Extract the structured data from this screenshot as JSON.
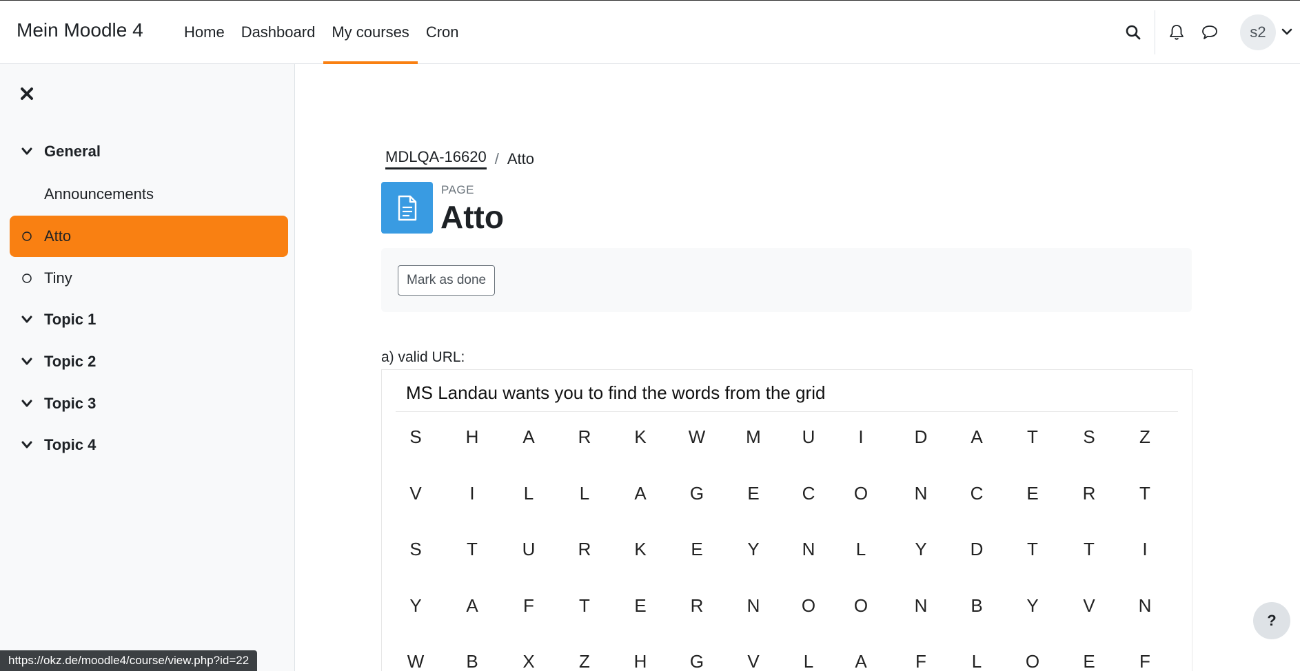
{
  "navbar": {
    "brand": "Mein Moodle 4",
    "links": [
      {
        "label": "Home"
      },
      {
        "label": "Dashboard"
      },
      {
        "label": "My courses",
        "active": true
      },
      {
        "label": "Cron"
      }
    ],
    "user_initials": "s2",
    "icons": [
      "search-icon",
      "bell-icon",
      "chat-icon",
      "chevron-down-icon"
    ]
  },
  "sidebar": {
    "close_icon": "close-icon",
    "sections": [
      {
        "label": "General",
        "expanded": true
      },
      {
        "label": "Announcements"
      },
      {
        "label": "Atto",
        "active": true
      },
      {
        "label": "Tiny"
      },
      {
        "label": "Topic 1"
      },
      {
        "label": "Topic 2"
      },
      {
        "label": "Topic 3"
      },
      {
        "label": "Topic 4"
      }
    ]
  },
  "breadcrumb": {
    "course": "MDLQA-16620",
    "separator": "/",
    "current": "Atto"
  },
  "page": {
    "kind": "PAGE",
    "title": "Atto",
    "icon": "document-icon"
  },
  "activity": {
    "mark_done_label": "Mark as done"
  },
  "content": {
    "valid_url_label": "a) valid URL:",
    "embed_title": "MS Landau wants you to find the words from the grid",
    "grid": [
      [
        "S",
        "H",
        "A",
        "R",
        "K",
        "W",
        "M",
        "U",
        "I",
        "D",
        "A",
        "T",
        "S",
        "Z"
      ],
      [
        "V",
        "I",
        "L",
        "L",
        "A",
        "G",
        "E",
        "C",
        "O",
        "N",
        "C",
        "E",
        "R",
        "T"
      ],
      [
        "S",
        "T",
        "U",
        "R",
        "K",
        "E",
        "Y",
        "N",
        "L",
        "Y",
        "D",
        "T",
        "T",
        "I"
      ],
      [
        "Y",
        "A",
        "F",
        "T",
        "E",
        "R",
        "N",
        "O",
        "O",
        "N",
        "B",
        "Y",
        "V",
        "N"
      ],
      [
        "W",
        "B",
        "X",
        "Z",
        "H",
        "G",
        "V",
        "L",
        "A",
        "F",
        "L",
        "O",
        "E",
        "F"
      ]
    ]
  },
  "status_bar": {
    "url": "https://okz.de/moodle4/course/view.php?id=22"
  },
  "colors": {
    "accent": "#f98012",
    "page_icon_bg": "#399be2",
    "sidebar_bg": "#f8f9fa"
  },
  "help_label": "?"
}
